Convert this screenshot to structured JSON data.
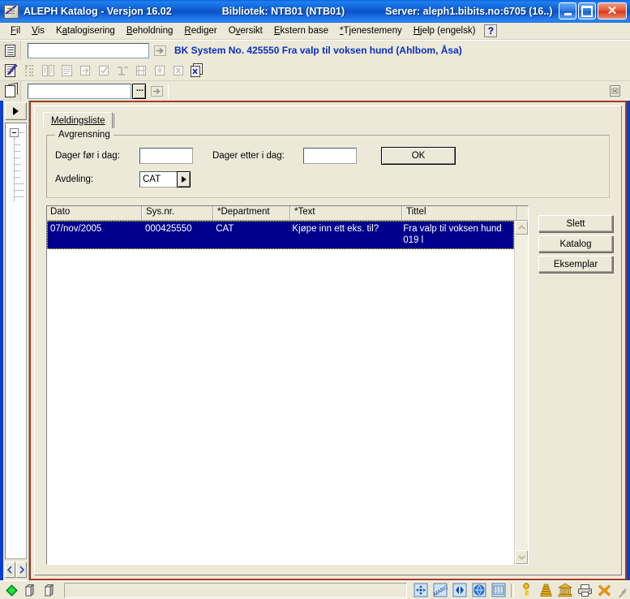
{
  "window": {
    "app_title": "ALEPH Katalog - Versjon 16.02",
    "library_label": "Bibliotek:  NTB01 (NTB01)",
    "server_label": "Server:  aleph1.bibits.no:6705 (16..)",
    "icon": "aleph-pen-icon",
    "minimize_label": "_",
    "maximize_label": "□",
    "close_label": "✕"
  },
  "menubar": {
    "items": [
      {
        "label": "Fil",
        "accel": "F"
      },
      {
        "label": "Vis",
        "accel": "V"
      },
      {
        "label": "Katalogisering",
        "accel": "a"
      },
      {
        "label": "Beholdning",
        "accel": "B"
      },
      {
        "label": "Rediger",
        "accel": "R"
      },
      {
        "label": "Oversikt",
        "accel": "v"
      },
      {
        "label": "Ekstern base",
        "accel": "E"
      },
      {
        "label": "*Tjenestemeny",
        "accel": "*"
      },
      {
        "label": "Hjelp (engelsk)",
        "accel": "H"
      }
    ],
    "help_button": "?"
  },
  "toolbar1": {
    "left_icon": "document-list-icon",
    "input_value": "",
    "go_icon": "arrow-right-icon",
    "record_label": "BK System No. 425550 Fra valp til voksen hund (Ahlbom, Åsa)"
  },
  "toolbar2": {
    "icons": [
      "edit-record-icon",
      "grid-dots-icon",
      "double-page-icon",
      "list-lines-icon",
      "link-page-icon",
      "check-box-icon",
      "merge-icon",
      "duplicate-icon",
      "move-node-icon",
      "delete-x-icon",
      "new-doc-x-icon"
    ]
  },
  "toolbar3": {
    "left_icon": "cube-box-icon",
    "input_value": "",
    "browse_label": "...",
    "go_icon": "arrow-right-icon",
    "right_icon": "window-close-doc-icon"
  },
  "leftrail": {
    "expand_icon": "triangle-right-icon",
    "tree_node_icon": "tree-collapse-icon",
    "prev_icon": "nav-prev-icon",
    "next_icon": "nav-next-icon"
  },
  "tabs": [
    {
      "label": "Meldingsliste",
      "active": true
    }
  ],
  "filter_group": {
    "title": "Avgrensning",
    "days_before_label": "Dager før i dag:",
    "days_before_value": "",
    "days_after_label": "Dager etter i dag:",
    "days_after_value": "",
    "ok_label": "OK",
    "department_label": "Avdeling:",
    "department_value": "CAT",
    "department_arrow": "triangle-right-icon"
  },
  "table": {
    "columns": [
      "Dato",
      "Sys.nr.",
      "*Department",
      "*Text",
      "Tittel"
    ],
    "rows": [
      {
        "selected": true,
        "cells": [
          "07/nov/2005",
          "000425550",
          "CAT",
          "Kjøpe inn ett eks. til?",
          "Fra valp til voksen hund 019 l"
        ]
      }
    ],
    "scroll_up_icon": "chevron-up-icon",
    "scroll_down_icon": "chevron-down-icon"
  },
  "side_buttons": [
    {
      "label": "Slett"
    },
    {
      "label": "Katalog"
    },
    {
      "label": "Eksemplar"
    }
  ],
  "statusbar": {
    "left_icons": [
      "green-diamond-icon",
      "cube-icon",
      "cube-icon"
    ],
    "message": "",
    "right_icons": [
      "blue-navigate-icon",
      "marc-icon",
      "blue-arrows-icon",
      "globe-icon",
      "grid-table-icon",
      "key-icon",
      "stack-books-icon",
      "library-building-icon",
      "printer-icon",
      "orange-x-icon"
    ],
    "resize_grip": "resize-grip-icon"
  },
  "colors": {
    "titlebar_blue": "#0c5ad0",
    "face": "#ece9d8",
    "panel_border_red": "#a33a22",
    "selection_navy": "#00008c",
    "record_label_blue": "#0a2fc0",
    "window_bg_blue": "#0a3ed6"
  }
}
